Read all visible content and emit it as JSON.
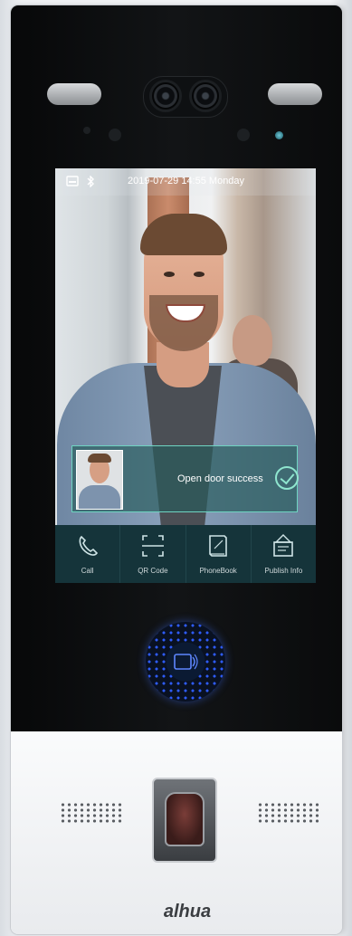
{
  "status_bar": {
    "datetime": "2019-07-29 14:55 Monday",
    "icons": [
      "card-icon",
      "bluetooth-icon"
    ]
  },
  "toast": {
    "message": "Open door success",
    "icon": "check-circle-icon"
  },
  "dock": {
    "items": [
      {
        "label": "Call",
        "icon": "phone-icon"
      },
      {
        "label": "QR Code",
        "icon": "qr-scan-icon"
      },
      {
        "label": "PhoneBook",
        "icon": "book-icon"
      },
      {
        "label": "Publish Info",
        "icon": "notice-board-icon"
      }
    ]
  },
  "brand": {
    "name": "alhua"
  },
  "colors": {
    "panel_black": "#0c0d0f",
    "toast_border": "#6fd4c2",
    "dock_bg": "#15343a",
    "nfc_blue": "#2e5cff"
  }
}
